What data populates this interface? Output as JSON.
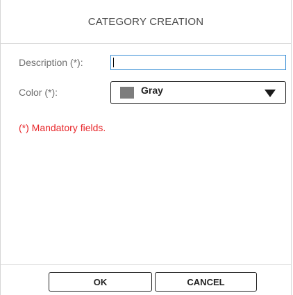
{
  "dialog": {
    "title": "CATEGORY CREATION"
  },
  "form": {
    "description_label": "Description (*):",
    "description_value": "",
    "color_label": "Color (*):",
    "color_value": "Gray",
    "color_swatch": "#7d7d7d",
    "mandatory_note": "(*) Mandatory fields.",
    "mandatory_color": "#e8262a"
  },
  "buttons": {
    "ok_label": "OK",
    "cancel_label": "CANCEL"
  },
  "icons": {
    "dropdown": "triangle-down-icon"
  }
}
